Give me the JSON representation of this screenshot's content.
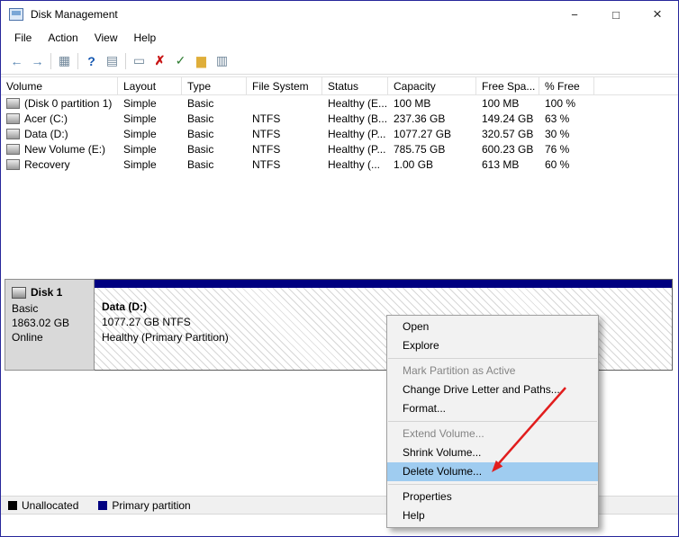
{
  "window": {
    "title": "Disk Management",
    "menu": [
      "File",
      "Action",
      "View",
      "Help"
    ],
    "controls": {
      "minimize": "−",
      "maximize": "□",
      "close": "×"
    }
  },
  "toolbar": {
    "icons": [
      {
        "name": "back",
        "glyph": "←"
      },
      {
        "name": "forward",
        "glyph": "→"
      },
      {
        "name": "console-tree",
        "glyph": "▦"
      },
      {
        "name": "help",
        "glyph": "?"
      },
      {
        "name": "detail-pane",
        "glyph": "▤"
      },
      {
        "name": "action-pane",
        "glyph": "▭"
      },
      {
        "name": "delete",
        "glyph": "✗"
      },
      {
        "name": "check-doc",
        "glyph": "✓"
      },
      {
        "name": "open-folder",
        "glyph": "▆"
      },
      {
        "name": "export-list",
        "glyph": "▥"
      }
    ]
  },
  "table": {
    "columns": [
      "Volume",
      "Layout",
      "Type",
      "File System",
      "Status",
      "Capacity",
      "Free Spa...",
      "% Free"
    ],
    "rows": [
      {
        "volume": "(Disk 0 partition 1)",
        "layout": "Simple",
        "type": "Basic",
        "file_system": "",
        "status": "Healthy (E...",
        "capacity": "100 MB",
        "free_space": "100 MB",
        "pct_free": "100 %"
      },
      {
        "volume": "Acer (C:)",
        "layout": "Simple",
        "type": "Basic",
        "file_system": "NTFS",
        "status": "Healthy (B...",
        "capacity": "237.36 GB",
        "free_space": "149.24 GB",
        "pct_free": "63 %"
      },
      {
        "volume": "Data (D:)",
        "layout": "Simple",
        "type": "Basic",
        "file_system": "NTFS",
        "status": "Healthy (P...",
        "capacity": "1077.27 GB",
        "free_space": "320.57 GB",
        "pct_free": "30 %"
      },
      {
        "volume": "New Volume (E:)",
        "layout": "Simple",
        "type": "Basic",
        "file_system": "NTFS",
        "status": "Healthy (P...",
        "capacity": "785.75 GB",
        "free_space": "600.23 GB",
        "pct_free": "76 %"
      },
      {
        "volume": "Recovery",
        "layout": "Simple",
        "type": "Basic",
        "file_system": "NTFS",
        "status": "Healthy (...",
        "capacity": "1.00 GB",
        "free_space": "613 MB",
        "pct_free": "60 %"
      }
    ]
  },
  "graph": {
    "disk": {
      "name": "Disk 1",
      "type": "Basic",
      "size": "1863.02 GB",
      "status": "Online"
    },
    "partition": {
      "label": "Data (D:)",
      "size": "1077.27 GB NTFS",
      "status": "Healthy (Primary Partition)"
    }
  },
  "context_menu": {
    "items": [
      {
        "label": "Open",
        "state": "normal"
      },
      {
        "label": "Explore",
        "state": "normal"
      },
      {
        "label": "Mark Partition as Active",
        "state": "disabled"
      },
      {
        "label": "Change Drive Letter and Paths...",
        "state": "normal"
      },
      {
        "label": "Format...",
        "state": "normal"
      },
      {
        "label": "Extend Volume...",
        "state": "disabled"
      },
      {
        "label": "Shrink Volume...",
        "state": "normal"
      },
      {
        "label": "Delete Volume...",
        "state": "selected"
      },
      {
        "label": "Properties",
        "state": "normal"
      },
      {
        "label": "Help",
        "state": "normal"
      }
    ]
  },
  "legend": {
    "unallocated_label": "Unallocated",
    "primary_label": "Primary partition"
  },
  "colors": {
    "menu_highlight": "#9fccf0",
    "primary_partition": "#000080",
    "unallocated": "#000000",
    "annotation_arrow": "#e11d1d",
    "window_border": "#27279b"
  }
}
